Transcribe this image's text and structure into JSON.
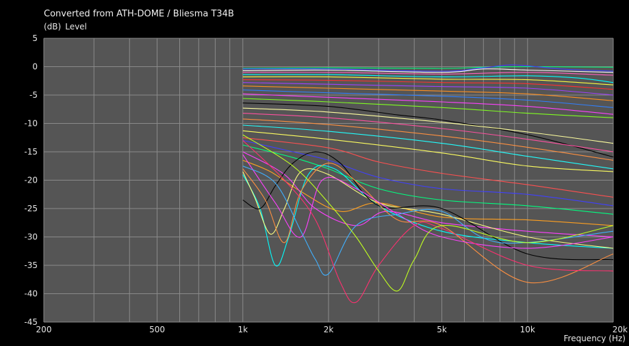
{
  "title": "Converted from ATH-DOME / Bliesma T34B",
  "y_unit": "(dB)",
  "y_name": "Level",
  "x_label": "Frequency  (Hz)",
  "colors": {
    "background": "#000000",
    "plot": "#555555",
    "grid": "#8a8a8a"
  },
  "chart_data": {
    "type": "line",
    "title": "Converted from ATH-DOME / Bliesma T34B",
    "xlabel": "Frequency (Hz)",
    "ylabel": "Level (dB)",
    "xscale": "log",
    "xlim": [
      200,
      20000
    ],
    "ylim": [
      -45,
      5
    ],
    "grid": true,
    "x_tick_labels": [
      {
        "value": 200,
        "label": "200"
      },
      {
        "value": 500,
        "label": "500"
      },
      {
        "value": 1000,
        "label": "1k"
      },
      {
        "value": 2000,
        "label": "2k"
      },
      {
        "value": 5000,
        "label": "5k"
      },
      {
        "value": 10000,
        "label": "10k"
      },
      {
        "value": 20000,
        "label": "20k"
      }
    ],
    "y_ticks": [
      5,
      0,
      -5,
      -10,
      -15,
      -20,
      -25,
      -30,
      -35,
      -40,
      -45
    ],
    "series": [
      {
        "color": "#00ff80",
        "x": [
          1000,
          2000,
          5000,
          7000,
          10000,
          20000
        ],
        "y": [
          -0.3,
          -0.2,
          -0.3,
          -0.1,
          0.0,
          -0.1
        ]
      },
      {
        "color": "#4040ff",
        "x": [
          1000,
          2000,
          5000,
          7000,
          9000,
          13000,
          20000
        ],
        "y": [
          -0.4,
          -0.4,
          -0.8,
          -0.2,
          0.3,
          -0.4,
          -0.8
        ]
      },
      {
        "color": "#ffffff",
        "x": [
          1000,
          2000,
          5000,
          7000,
          10000,
          20000
        ],
        "y": [
          -0.7,
          -0.6,
          -1.0,
          -0.4,
          -0.6,
          -1.0
        ]
      },
      {
        "color": "#ff60c0",
        "x": [
          1000,
          2000,
          5000,
          10000,
          20000
        ],
        "y": [
          -1.0,
          -1.0,
          -1.3,
          -1.0,
          -1.5
        ]
      },
      {
        "color": "#00ffff",
        "x": [
          1000,
          2000,
          5000,
          10000,
          15000,
          20000
        ],
        "y": [
          -1.4,
          -1.4,
          -1.8,
          -1.6,
          -2.0,
          -2.8
        ]
      },
      {
        "color": "#ffff40",
        "x": [
          1000,
          2000,
          5000,
          10000,
          20000
        ],
        "y": [
          -1.8,
          -1.8,
          -2.2,
          -2.3,
          -3.2
        ]
      },
      {
        "color": "#ff3030",
        "x": [
          1000,
          2000,
          5000,
          10000,
          20000
        ],
        "y": [
          -2.3,
          -2.4,
          -2.8,
          -3.0,
          -4.0
        ]
      },
      {
        "color": "#a040ff",
        "x": [
          1000,
          2000,
          5000,
          10000,
          20000
        ],
        "y": [
          -2.8,
          -3.1,
          -3.5,
          -3.8,
          -5.0
        ]
      },
      {
        "color": "#ff9020",
        "x": [
          1000,
          2000,
          5000,
          10000,
          20000
        ],
        "y": [
          -3.4,
          -3.8,
          -4.3,
          -4.8,
          -6.0
        ]
      },
      {
        "color": "#3080ff",
        "x": [
          1000,
          2000,
          5000,
          10000,
          20000
        ],
        "y": [
          -4.1,
          -4.6,
          -5.2,
          -5.9,
          -7.2
        ]
      },
      {
        "color": "#ff40ff",
        "x": [
          1000,
          2000,
          5000,
          10000,
          20000
        ],
        "y": [
          -4.8,
          -5.4,
          -6.2,
          -7.0,
          -8.4
        ]
      },
      {
        "color": "#80ff20",
        "x": [
          1000,
          2000,
          5000,
          10000,
          20000
        ],
        "y": [
          -5.6,
          -6.2,
          -7.2,
          -8.2,
          -9.0
        ]
      },
      {
        "color": "#000000",
        "x": [
          1000,
          2000,
          3500,
          5000,
          10000,
          20000
        ],
        "y": [
          -6.4,
          -7.0,
          -8.5,
          -9.4,
          -12.0,
          -15.9
        ]
      },
      {
        "color": "#ffffa0",
        "x": [
          1000,
          2000,
          5000,
          10000,
          20000
        ],
        "y": [
          -7.3,
          -8.0,
          -9.8,
          -11.5,
          -13.5
        ]
      },
      {
        "color": "#ff50a0",
        "x": [
          1000,
          2000,
          5000,
          10000,
          20000
        ],
        "y": [
          -8.2,
          -9.0,
          -10.9,
          -12.8,
          -15.0
        ]
      },
      {
        "color": "#ff9040",
        "x": [
          1000,
          2000,
          5000,
          10000,
          20000
        ],
        "y": [
          -9.2,
          -10.2,
          -12.2,
          -14.2,
          -16.5
        ]
      },
      {
        "color": "#20ffff",
        "x": [
          1000,
          2000,
          5000,
          10000,
          20000
        ],
        "y": [
          -10.3,
          -11.4,
          -13.5,
          -15.8,
          -18.0
        ]
      },
      {
        "color": "#ffff60",
        "x": [
          1000,
          2000,
          5000,
          10000,
          20000
        ],
        "y": [
          -11.3,
          -12.8,
          -15.2,
          -17.5,
          -18.5
        ]
      },
      {
        "color": "#ff5050",
        "x": [
          1000,
          2000,
          3000,
          5000,
          10000,
          20000
        ],
        "y": [
          -12.5,
          -14.3,
          -16.8,
          -18.8,
          -20.8,
          -23.0
        ]
      },
      {
        "color": "#4040ff",
        "x": [
          1000,
          1500,
          2000,
          3000,
          5000,
          10000,
          20000
        ],
        "y": [
          -13.0,
          -15.0,
          -16.5,
          -19.5,
          -21.5,
          -22.5,
          -24.5
        ]
      },
      {
        "color": "#00ff80",
        "x": [
          1000,
          1500,
          2000,
          3000,
          5000,
          10000,
          20000
        ],
        "y": [
          -13.8,
          -16.0,
          -18.0,
          -21.5,
          -23.5,
          -24.5,
          -26.0
        ]
      },
      {
        "color": "#ffa020",
        "x": [
          1000,
          1250,
          1600,
          2200,
          3000,
          5000,
          10000,
          20000
        ],
        "y": [
          -16.5,
          -18.5,
          -22.0,
          -25.5,
          -24.0,
          -26.5,
          -27.0,
          -28.0
        ]
      },
      {
        "color": "#ff40ff",
        "x": [
          1000,
          1400,
          1800,
          2500,
          3200,
          5000,
          10000,
          20000
        ],
        "y": [
          -15.0,
          -19.0,
          -25.0,
          -28.0,
          -25.5,
          -27.5,
          -29.0,
          -30.0
        ]
      },
      {
        "color": "#00ffff",
        "x": [
          1000,
          1150,
          1300,
          1450,
          1700,
          2100,
          3000,
          5000,
          10000,
          20000
        ],
        "y": [
          -19.0,
          -25.0,
          -35.0,
          -30.0,
          -19.0,
          -18.0,
          -24.5,
          -29.0,
          -31.0,
          -32.0
        ]
      },
      {
        "color": "#ffff80",
        "x": [
          1000,
          1100,
          1250,
          1400,
          1600,
          2000,
          3000,
          5000,
          10000,
          20000
        ],
        "y": [
          -18.5,
          -23.0,
          -29.5,
          -25.0,
          -18.5,
          -19.0,
          -24.0,
          -26.0,
          -30.0,
          -32.0
        ]
      },
      {
        "color": "#000000",
        "x": [
          1000,
          1150,
          1300,
          1500,
          1800,
          2200,
          3000,
          5000,
          10000,
          20000
        ],
        "y": [
          -23.5,
          -25.0,
          -21.0,
          -17.0,
          -15.0,
          -17.0,
          -24.5,
          -25.0,
          -33.0,
          -34.0
        ]
      },
      {
        "color": "#ff9040",
        "x": [
          1000,
          1200,
          1400,
          1600,
          2000,
          2600,
          3500,
          5000,
          10000,
          20000
        ],
        "y": [
          -18.0,
          -23.5,
          -31.0,
          -22.0,
          -17.0,
          -21.0,
          -27.0,
          -28.0,
          -38.0,
          -33.0
        ]
      },
      {
        "color": "#ff40ff",
        "x": [
          1000,
          1300,
          1600,
          1900,
          2500,
          3500,
          5000,
          10000,
          20000
        ],
        "y": [
          -15.5,
          -24.0,
          -30.0,
          -20.0,
          -21.5,
          -26.0,
          -30.0,
          -32.0,
          -30.0
        ]
      },
      {
        "color": "#40b0ff",
        "x": [
          1000,
          1300,
          1600,
          1800,
          2000,
          2500,
          3500,
          5000,
          8000,
          20000
        ],
        "y": [
          -17.5,
          -20.5,
          -29.0,
          -34.0,
          -36.5,
          -28.0,
          -26.0,
          -25.5,
          -31.0,
          -29.0
        ]
      },
      {
        "color": "#ff3070",
        "x": [
          1000,
          1400,
          1800,
          2200,
          2500,
          3000,
          4000,
          5000,
          10000,
          20000
        ],
        "y": [
          -13.0,
          -20.0,
          -27.0,
          -38.0,
          -41.5,
          -35.0,
          -28.0,
          -28.5,
          -35.0,
          -36.0
        ]
      },
      {
        "color": "#c0ff20",
        "x": [
          1000,
          1500,
          2000,
          2500,
          3000,
          3500,
          4000,
          5000,
          10000,
          20000
        ],
        "y": [
          -12.0,
          -17.5,
          -24.0,
          -30.0,
          -36.0,
          -39.5,
          -34.0,
          -28.0,
          -31.0,
          -28.0
        ]
      }
    ]
  }
}
